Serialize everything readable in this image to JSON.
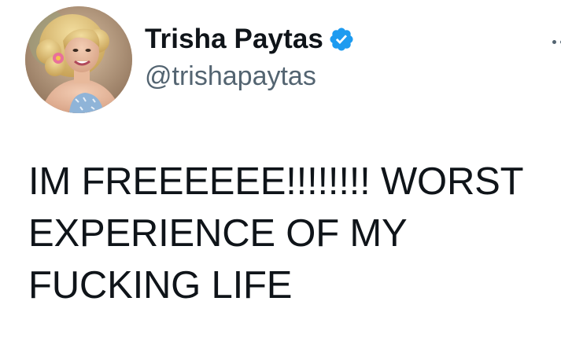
{
  "tweet": {
    "author": {
      "display_name": "Trisha Paytas",
      "handle": "@trishapaytas",
      "verified": true,
      "avatar_icon": "profile-photo"
    },
    "text": "IM FREEEEEE!!!!!!!! WORST\nEXPERIENCE OF MY\nFUCKING LIFE",
    "more_icon": "more-horizontal-icon"
  },
  "colors": {
    "text_primary": "#0f1419",
    "text_secondary": "#536471",
    "verified_badge": "#1d9bf0",
    "background": "#ffffff"
  }
}
